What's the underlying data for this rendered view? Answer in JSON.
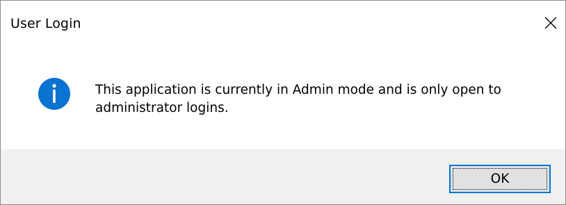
{
  "dialog": {
    "title": "User Login",
    "icon": "info-icon",
    "icon_color": "#0a72d1",
    "message": "This application is currently in Admin mode and is only open to administrator logins.",
    "buttons": {
      "ok_label": "OK"
    }
  },
  "colors": {
    "footer_bg": "#f0f0f0",
    "button_focus_border": "#0078d7",
    "button_bg": "#e1e1e1"
  }
}
